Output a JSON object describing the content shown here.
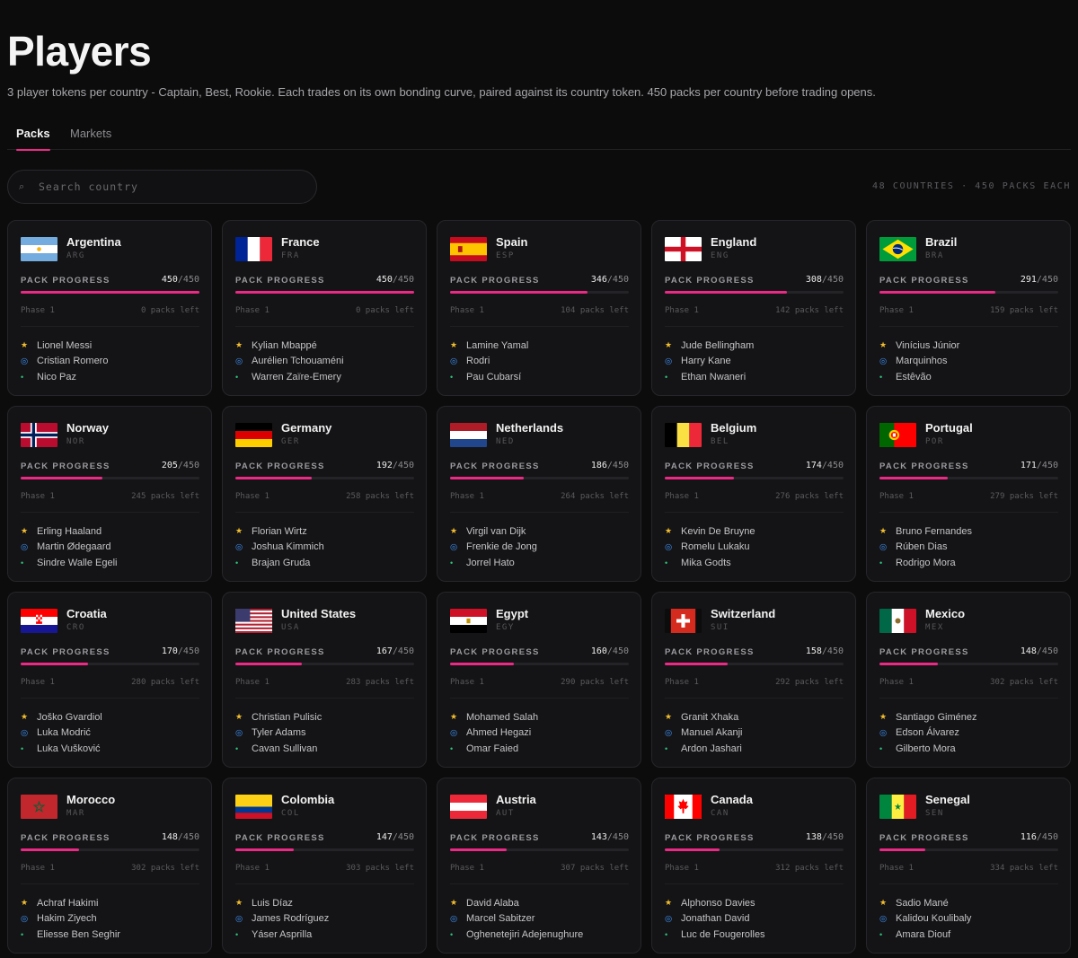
{
  "page": {
    "title": "Players",
    "subtitle": "3 player tokens per country - Captain, Best, Rookie. Each trades on its own bonding curve, paired against its country token. 450 packs per country before trading opens."
  },
  "tabs": [
    {
      "label": "Packs",
      "active": true
    },
    {
      "label": "Markets",
      "active": false
    }
  ],
  "search": {
    "placeholder": "Search country",
    "value": "",
    "icon": "search-icon"
  },
  "meta": "48 COUNTRIES · 450 PACKS EACH",
  "labels": {
    "pack_progress": "PACK PROGRESS",
    "total": "/450"
  },
  "colors": {
    "accent": "#ec2a86",
    "captain_star": "#f3be2e",
    "best": "#3d8ef0",
    "rookie": "#2ec27e"
  },
  "countries": [
    {
      "name": "Argentina",
      "code": "ARG",
      "flag": "argentina-flag",
      "sold": "450",
      "fraction": 1.0,
      "phase": "Phase 1",
      "left": "0 packs left",
      "players": [
        "Lionel Messi",
        "Cristian Romero",
        "Nico Paz"
      ]
    },
    {
      "name": "France",
      "code": "FRA",
      "flag": "france-flag",
      "sold": "450",
      "fraction": 1.0,
      "phase": "Phase 1",
      "left": "0 packs left",
      "players": [
        "Kylian Mbappé",
        "Aurélien Tchouaméni",
        "Warren Zaïre-Emery"
      ]
    },
    {
      "name": "Spain",
      "code": "ESP",
      "flag": "spain-flag",
      "sold": "346",
      "fraction": 0.769,
      "phase": "Phase 1",
      "left": "104 packs left",
      "players": [
        "Lamine Yamal",
        "Rodri",
        "Pau Cubarsí"
      ]
    },
    {
      "name": "England",
      "code": "ENG",
      "flag": "england-flag",
      "sold": "308",
      "fraction": 0.684,
      "phase": "Phase 1",
      "left": "142 packs left",
      "players": [
        "Jude Bellingham",
        "Harry Kane",
        "Ethan Nwaneri"
      ]
    },
    {
      "name": "Brazil",
      "code": "BRA",
      "flag": "brazil-flag",
      "sold": "291",
      "fraction": 0.647,
      "phase": "Phase 1",
      "left": "159 packs left",
      "players": [
        "Vinícius Júnior",
        "Marquinhos",
        "Estêvão"
      ]
    },
    {
      "name": "Norway",
      "code": "NOR",
      "flag": "norway-flag",
      "sold": "205",
      "fraction": 0.456,
      "phase": "Phase 1",
      "left": "245 packs left",
      "players": [
        "Erling Haaland",
        "Martin Ødegaard",
        "Sindre Walle Egeli"
      ]
    },
    {
      "name": "Germany",
      "code": "GER",
      "flag": "germany-flag",
      "sold": "192",
      "fraction": 0.427,
      "phase": "Phase 1",
      "left": "258 packs left",
      "players": [
        "Florian Wirtz",
        "Joshua Kimmich",
        "Brajan Gruda"
      ]
    },
    {
      "name": "Netherlands",
      "code": "NED",
      "flag": "netherlands-flag",
      "sold": "186",
      "fraction": 0.413,
      "phase": "Phase 1",
      "left": "264 packs left",
      "players": [
        "Virgil van Dijk",
        "Frenkie de Jong",
        "Jorrel Hato"
      ]
    },
    {
      "name": "Belgium",
      "code": "BEL",
      "flag": "belgium-flag",
      "sold": "174",
      "fraction": 0.387,
      "phase": "Phase 1",
      "left": "276 packs left",
      "players": [
        "Kevin De Bruyne",
        "Romelu Lukaku",
        "Mika Godts"
      ]
    },
    {
      "name": "Portugal",
      "code": "POR",
      "flag": "portugal-flag",
      "sold": "171",
      "fraction": 0.38,
      "phase": "Phase 1",
      "left": "279 packs left",
      "players": [
        "Bruno Fernandes",
        "Rúben Dias",
        "Rodrigo Mora"
      ]
    },
    {
      "name": "Croatia",
      "code": "CRO",
      "flag": "croatia-flag",
      "sold": "170",
      "fraction": 0.378,
      "phase": "Phase 1",
      "left": "280 packs left",
      "players": [
        "Joško Gvardiol",
        "Luka Modrić",
        "Luka Vušković"
      ]
    },
    {
      "name": "United States",
      "code": "USA",
      "flag": "usa-flag",
      "sold": "167",
      "fraction": 0.371,
      "phase": "Phase 1",
      "left": "283 packs left",
      "players": [
        "Christian Pulisic",
        "Tyler Adams",
        "Cavan Sullivan"
      ]
    },
    {
      "name": "Egypt",
      "code": "EGY",
      "flag": "egypt-flag",
      "sold": "160",
      "fraction": 0.356,
      "phase": "Phase 1",
      "left": "290 packs left",
      "players": [
        "Mohamed Salah",
        "Ahmed Hegazi",
        "Omar Faied"
      ]
    },
    {
      "name": "Switzerland",
      "code": "SUI",
      "flag": "switzerland-flag",
      "sold": "158",
      "fraction": 0.351,
      "phase": "Phase 1",
      "left": "292 packs left",
      "players": [
        "Granit Xhaka",
        "Manuel Akanji",
        "Ardon Jashari"
      ]
    },
    {
      "name": "Mexico",
      "code": "MEX",
      "flag": "mexico-flag",
      "sold": "148",
      "fraction": 0.329,
      "phase": "Phase 1",
      "left": "302 packs left",
      "players": [
        "Santiago Giménez",
        "Edson Álvarez",
        "Gilberto Mora"
      ]
    },
    {
      "name": "Morocco",
      "code": "MAR",
      "flag": "morocco-flag",
      "sold": "148",
      "fraction": 0.329,
      "phase": "Phase 1",
      "left": "302 packs left",
      "players": [
        "Achraf Hakimi",
        "Hakim Ziyech",
        "Eliesse Ben Seghir"
      ]
    },
    {
      "name": "Colombia",
      "code": "COL",
      "flag": "colombia-flag",
      "sold": "147",
      "fraction": 0.327,
      "phase": "Phase 1",
      "left": "303 packs left",
      "players": [
        "Luis Díaz",
        "James Rodríguez",
        "Yáser Asprilla"
      ]
    },
    {
      "name": "Austria",
      "code": "AUT",
      "flag": "austria-flag",
      "sold": "143",
      "fraction": 0.318,
      "phase": "Phase 1",
      "left": "307 packs left",
      "players": [
        "David Alaba",
        "Marcel Sabitzer",
        "Oghenetejiri Adejenughure"
      ]
    },
    {
      "name": "Canada",
      "code": "CAN",
      "flag": "canada-flag",
      "sold": "138",
      "fraction": 0.307,
      "phase": "Phase 1",
      "left": "312 packs left",
      "players": [
        "Alphonso Davies",
        "Jonathan David",
        "Luc de Fougerolles"
      ]
    },
    {
      "name": "Senegal",
      "code": "SEN",
      "flag": "senegal-flag",
      "sold": "116",
      "fraction": 0.258,
      "phase": "Phase 1",
      "left": "334 packs left",
      "players": [
        "Sadio Mané",
        "Kalidou Koulibaly",
        "Amara Diouf"
      ]
    }
  ]
}
